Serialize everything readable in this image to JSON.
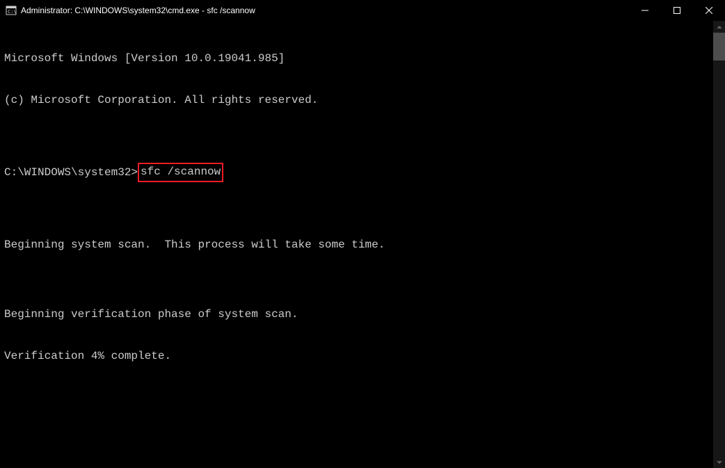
{
  "window": {
    "title": "Administrator: C:\\WINDOWS\\system32\\cmd.exe - sfc  /scannow"
  },
  "terminal": {
    "line1": "Microsoft Windows [Version 10.0.19041.985]",
    "line2": "(c) Microsoft Corporation. All rights reserved.",
    "blank1": "",
    "prompt": "C:\\WINDOWS\\system32>",
    "command": "sfc /scannow",
    "blank2": "",
    "line3": "Beginning system scan.  This process will take some time.",
    "blank3": "",
    "line4": "Beginning verification phase of system scan.",
    "line5": "Verification 4% complete."
  }
}
